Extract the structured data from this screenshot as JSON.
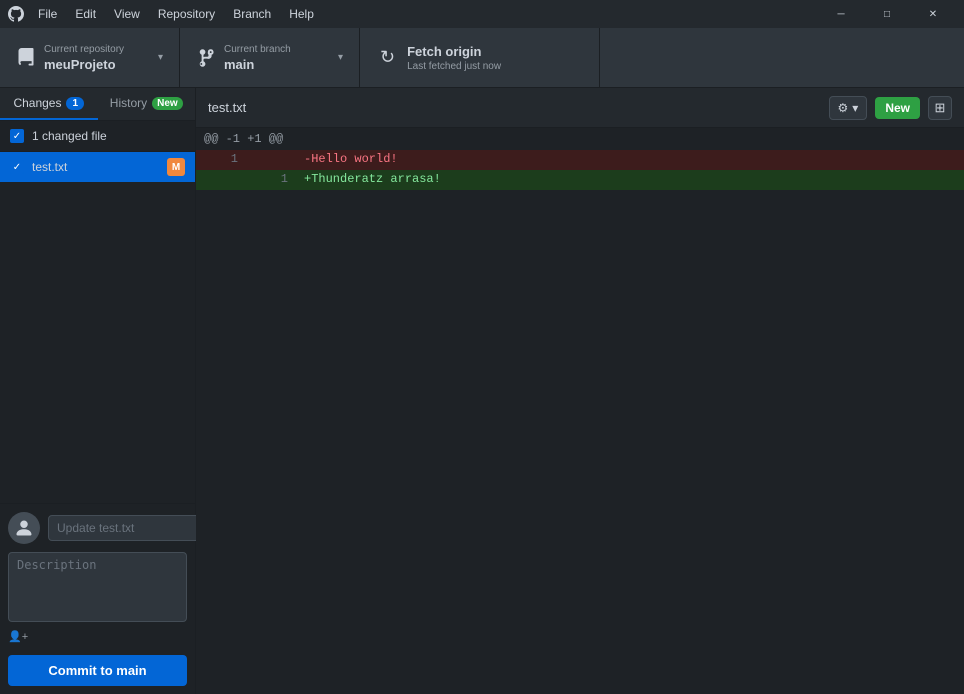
{
  "titlebar": {
    "menu_items": [
      "File",
      "Edit",
      "View",
      "Repository",
      "Branch",
      "Help"
    ],
    "controls": {
      "minimize": "─",
      "maximize": "□",
      "close": "✕"
    }
  },
  "toolbar": {
    "repo_label": "Current repository",
    "repo_name": "meuProjeto",
    "branch_label": "Current branch",
    "branch_name": "main",
    "fetch_title": "Fetch origin",
    "fetch_sub": "Last fetched just now"
  },
  "sidebar": {
    "tab_changes_label": "Changes",
    "tab_changes_badge": "1",
    "tab_history_label": "History",
    "tab_history_badge": "New",
    "changed_header": "1 changed file",
    "file_name": "test.txt",
    "commit_summary_placeholder": "Update test.txt",
    "commit_description_placeholder": "Description",
    "co_author_label": "👤+",
    "commit_btn_label": "Commit to main"
  },
  "diff": {
    "filename": "test.txt",
    "hunk_header": "@@ -1 +1 @@",
    "lines": [
      {
        "type": "removed",
        "old_num": "1",
        "new_num": "",
        "content": "-Hello world!"
      },
      {
        "type": "added",
        "old_num": "",
        "new_num": "1",
        "content": "+Thunderatz arrasa!"
      }
    ]
  }
}
